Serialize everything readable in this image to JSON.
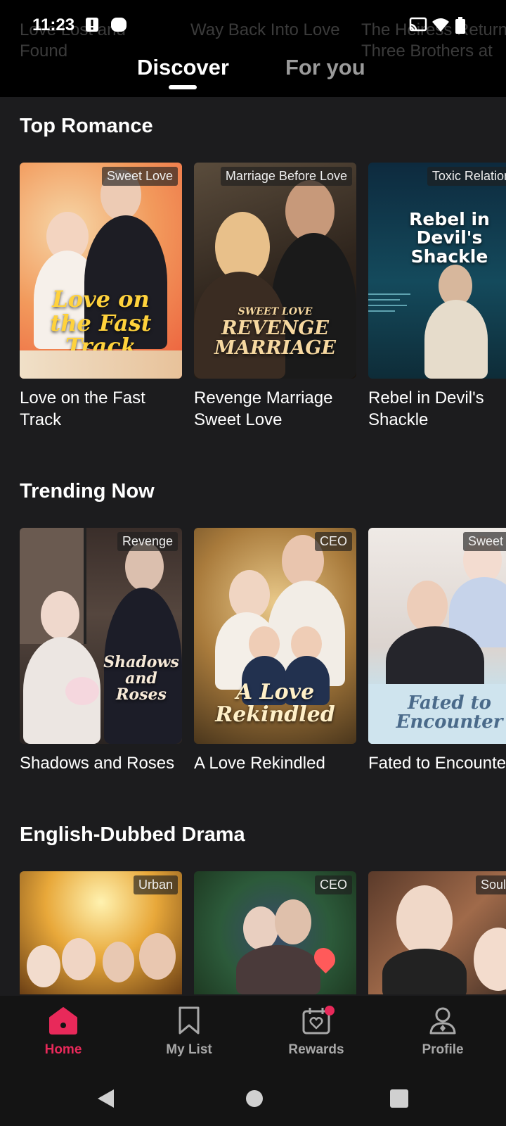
{
  "status_bar": {
    "time": "11:23",
    "icons": [
      "alert-icon",
      "record-icon",
      "cast-icon",
      "wifi-icon",
      "battery-icon"
    ]
  },
  "background_titles": [
    {
      "line1": "Love Lost and",
      "line2": "Found"
    },
    {
      "line1": "Way Back Into Love",
      "line2": ""
    },
    {
      "line1": "The Heiress Returns",
      "line2": "Three Brothers at"
    }
  ],
  "header": {
    "tabs": [
      {
        "label": "Discover",
        "active": true
      },
      {
        "label": "For you",
        "active": false
      }
    ]
  },
  "sections": [
    {
      "title": "Top Romance",
      "items": [
        {
          "title": "Love on the Fast Track",
          "tag": "Sweet Love",
          "poster_text": "Love on the Fast Track"
        },
        {
          "title": "Revenge Marriage Sweet Love",
          "tag": "Marriage Before Love",
          "poster_text_small": "SWEET LOVE",
          "poster_text": "REVENGE MARRIAGE"
        },
        {
          "title": "Rebel in Devil's Shackle",
          "tag": "Toxic Relationship",
          "poster_text": "Rebel in Devil's Shackle"
        }
      ]
    },
    {
      "title": "Trending Now",
      "items": [
        {
          "title": "Shadows and Roses",
          "tag": "Revenge",
          "poster_text": "Shadows and Roses"
        },
        {
          "title": "A Love Rekindled",
          "tag": "CEO",
          "poster_text": "A Love Rekindled"
        },
        {
          "title": "Fated to Encounter",
          "tag": "Sweet Love",
          "poster_text": "Fated to Encounter"
        }
      ]
    },
    {
      "title": "English-Dubbed Drama",
      "items": [
        {
          "title": "",
          "tag": "Urban"
        },
        {
          "title": "",
          "tag": "CEO"
        },
        {
          "title": "",
          "tag": "Soulmate"
        }
      ]
    }
  ],
  "bottom_nav": [
    {
      "label": "Home",
      "icon": "home-icon",
      "active": true
    },
    {
      "label": "My List",
      "icon": "bookmark-icon",
      "active": false
    },
    {
      "label": "Rewards",
      "icon": "gift-calendar-icon",
      "active": false,
      "badge": true
    },
    {
      "label": "Profile",
      "icon": "profile-icon",
      "active": false
    }
  ],
  "colors": {
    "accent": "#e8295a",
    "background": "#1c1c1e",
    "header": "#000000",
    "tab_inactive": "#9a9a9a"
  }
}
